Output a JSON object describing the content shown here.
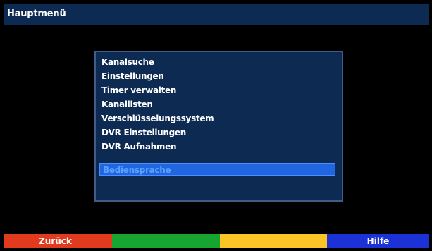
{
  "header": {
    "title": "Hauptmenü"
  },
  "menu": {
    "items": [
      {
        "label": "Kanalsuche"
      },
      {
        "label": "Einstellungen"
      },
      {
        "label": "Timer verwalten"
      },
      {
        "label": "Kanallisten"
      },
      {
        "label": "Verschlüsselungssystem"
      },
      {
        "label": "DVR Einstellungen"
      },
      {
        "label": "DVR Aufnahmen"
      }
    ],
    "selected": {
      "label": "Bediensprache"
    }
  },
  "function_keys": {
    "red": {
      "label": "Zurück",
      "color": "#e23a1e"
    },
    "green": {
      "label": "",
      "color": "#16a530"
    },
    "yellow": {
      "label": "",
      "color": "#fbc527"
    },
    "blue": {
      "label": "Hilfe",
      "color": "#1b33d6"
    }
  },
  "colors": {
    "background": "#000000",
    "panel": "#0c2a52",
    "panel_border": "#3f5d86",
    "highlight": "#1f66e0",
    "text": "#ffffff"
  }
}
